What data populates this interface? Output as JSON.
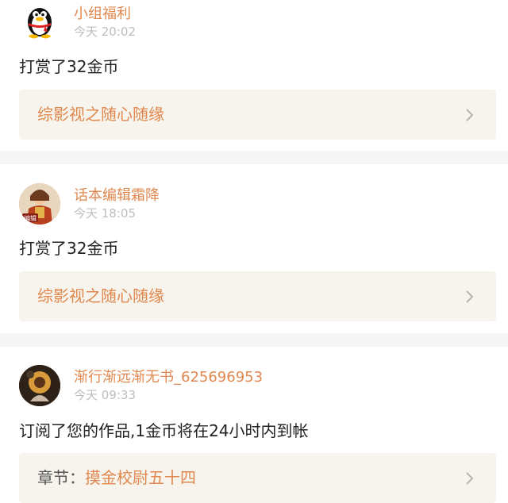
{
  "notifications": [
    {
      "author": "小组福利",
      "time": "今天 20:02",
      "message": "打赏了32金币",
      "link": {
        "prefix": "",
        "title": "综影视之随心随缘"
      },
      "avatar_icon": "qq-penguin-icon"
    },
    {
      "author": "话本编辑霜降",
      "time": "今天 18:05",
      "message": "打赏了32金币",
      "link": {
        "prefix": "",
        "title": "综影视之随心随缘"
      },
      "avatar_icon": "editor-avatar-photo",
      "avatar_badge": "编辑"
    },
    {
      "author": "渐行渐远渐无书_625696953",
      "time": "今天 09:33",
      "message": "订阅了您的作品,1金币将在24小时内到帐",
      "link": {
        "prefix": "章节：",
        "title": "摸金校尉五十四"
      },
      "avatar_icon": "sunflower-avatar-photo"
    }
  ],
  "colors": {
    "accent": "#e0884f",
    "link_bg": "#f6f4ec",
    "separator": "#f5f5f5",
    "muted": "#bdbdbd"
  }
}
